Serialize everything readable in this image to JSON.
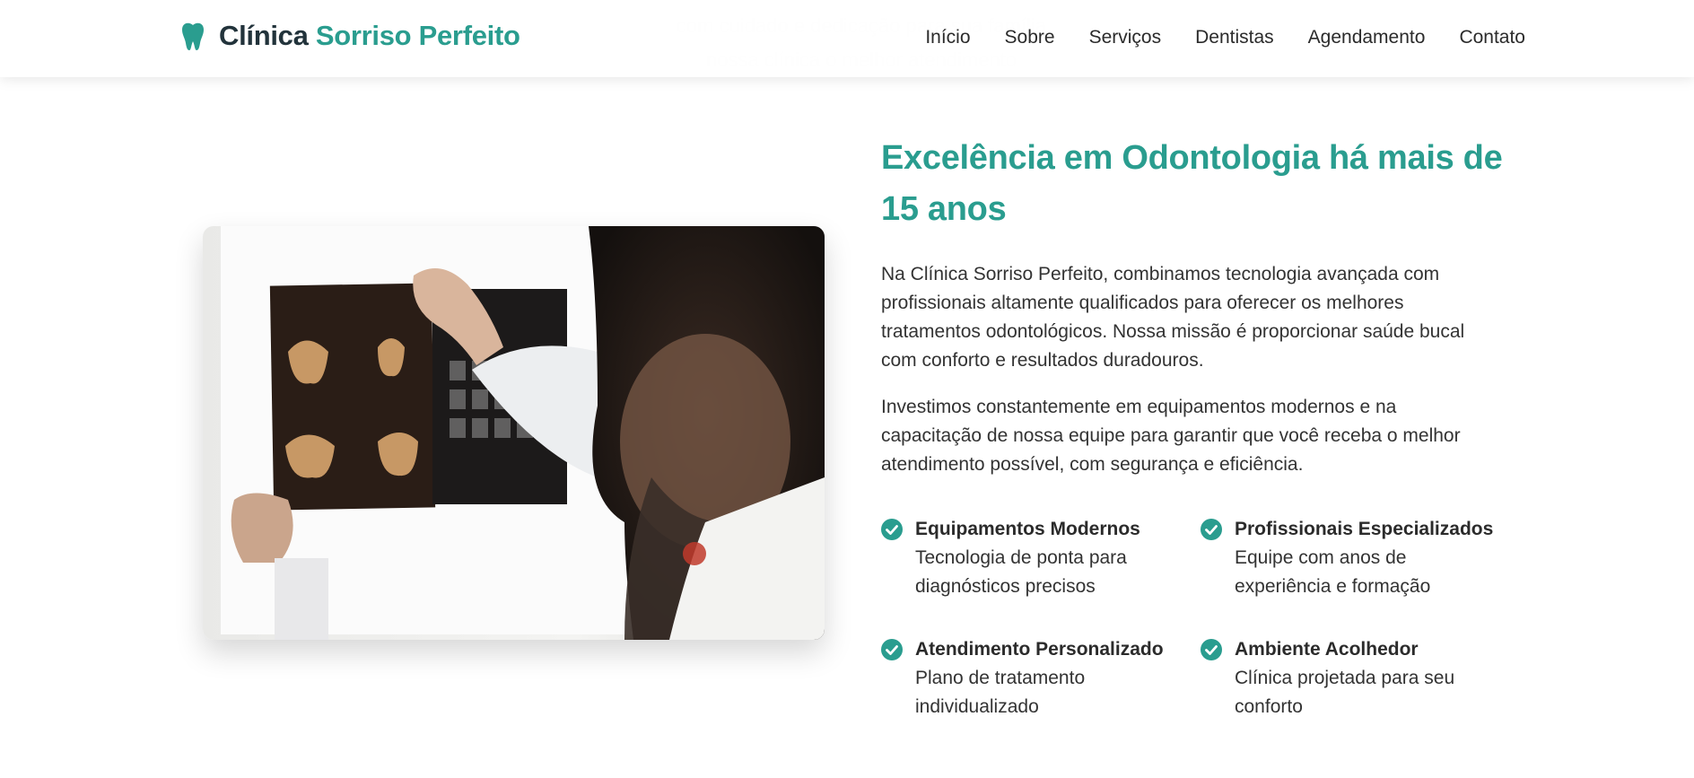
{
  "brand": {
    "name_part1": "Clínica",
    "name_part2": "Sorriso Perfeito",
    "icon": "tooth-icon",
    "color": "#2a9d8f"
  },
  "nav": [
    "Início",
    "Sobre",
    "Serviços",
    "Dentistas",
    "Agendamento",
    "Contato"
  ],
  "about": {
    "title": "Excelência em Odontologia há mais de 15 anos",
    "paragraph1": "Na Clínica Sorriso Perfeito, combinamos tecnologia avançada com profissionais altamente qualificados para oferecer os melhores tratamentos odontológicos. Nossa missão é proporcionar saúde bucal com conforto e resultados duradouros.",
    "paragraph2": "Investimos constantemente em equipamentos modernos e na capacitação de nossa equipe para garantir que você receba o melhor atendimento possível, com segurança e eficiência.",
    "features": [
      {
        "title": "Equipamentos Modernos",
        "desc": "Tecnologia de ponta para diagnósticos precisos",
        "icon": "check-circle-icon"
      },
      {
        "title": "Profissionais Especializados",
        "desc": "Equipe com anos de experiência e formação",
        "icon": "check-circle-icon"
      },
      {
        "title": "Atendimento Personalizado",
        "desc": "Plano de tratamento individualizado",
        "icon": "check-circle-icon"
      },
      {
        "title": "Ambiente Acolhedor",
        "desc": "Clínica projetada para seu conforto",
        "icon": "check-circle-icon"
      }
    ]
  }
}
